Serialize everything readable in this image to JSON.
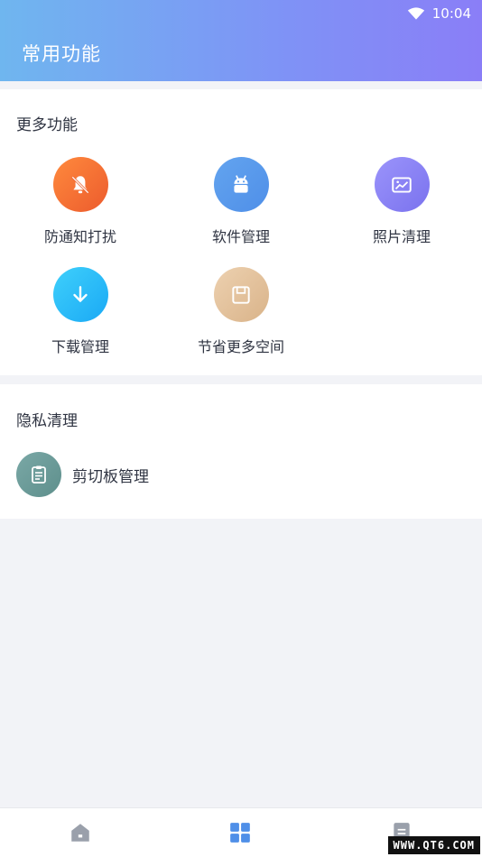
{
  "status_bar": {
    "time": "10:04",
    "icons": [
      "wifi-icon"
    ]
  },
  "header": {
    "title": "常用功能"
  },
  "more_features": {
    "title": "更多功能",
    "items": [
      {
        "label": "防通知打扰",
        "icon": "bell-off-icon",
        "color": "#f0692f"
      },
      {
        "label": "软件管理",
        "icon": "android-icon",
        "color": "#5b9bec"
      },
      {
        "label": "照片清理",
        "icon": "image-icon",
        "color": "#8a84f5"
      },
      {
        "label": "下载管理",
        "icon": "download-icon",
        "color": "#2dbff8"
      },
      {
        "label": "节省更多空间",
        "icon": "save-icon",
        "color": "#e3c29d"
      }
    ]
  },
  "privacy": {
    "title": "隐私清理",
    "items": [
      {
        "label": "剪切板管理",
        "icon": "clipboard-icon",
        "color": "#6e9c99"
      }
    ]
  },
  "bottom_nav": {
    "items": [
      {
        "icon": "home-icon",
        "active": false
      },
      {
        "icon": "grid-icon",
        "active": true
      },
      {
        "icon": "document-icon",
        "active": false
      }
    ],
    "active_color": "#4f8fe8",
    "inactive_color": "#9aa0ab"
  },
  "watermark": {
    "text": "WWW.QT6.COM"
  }
}
